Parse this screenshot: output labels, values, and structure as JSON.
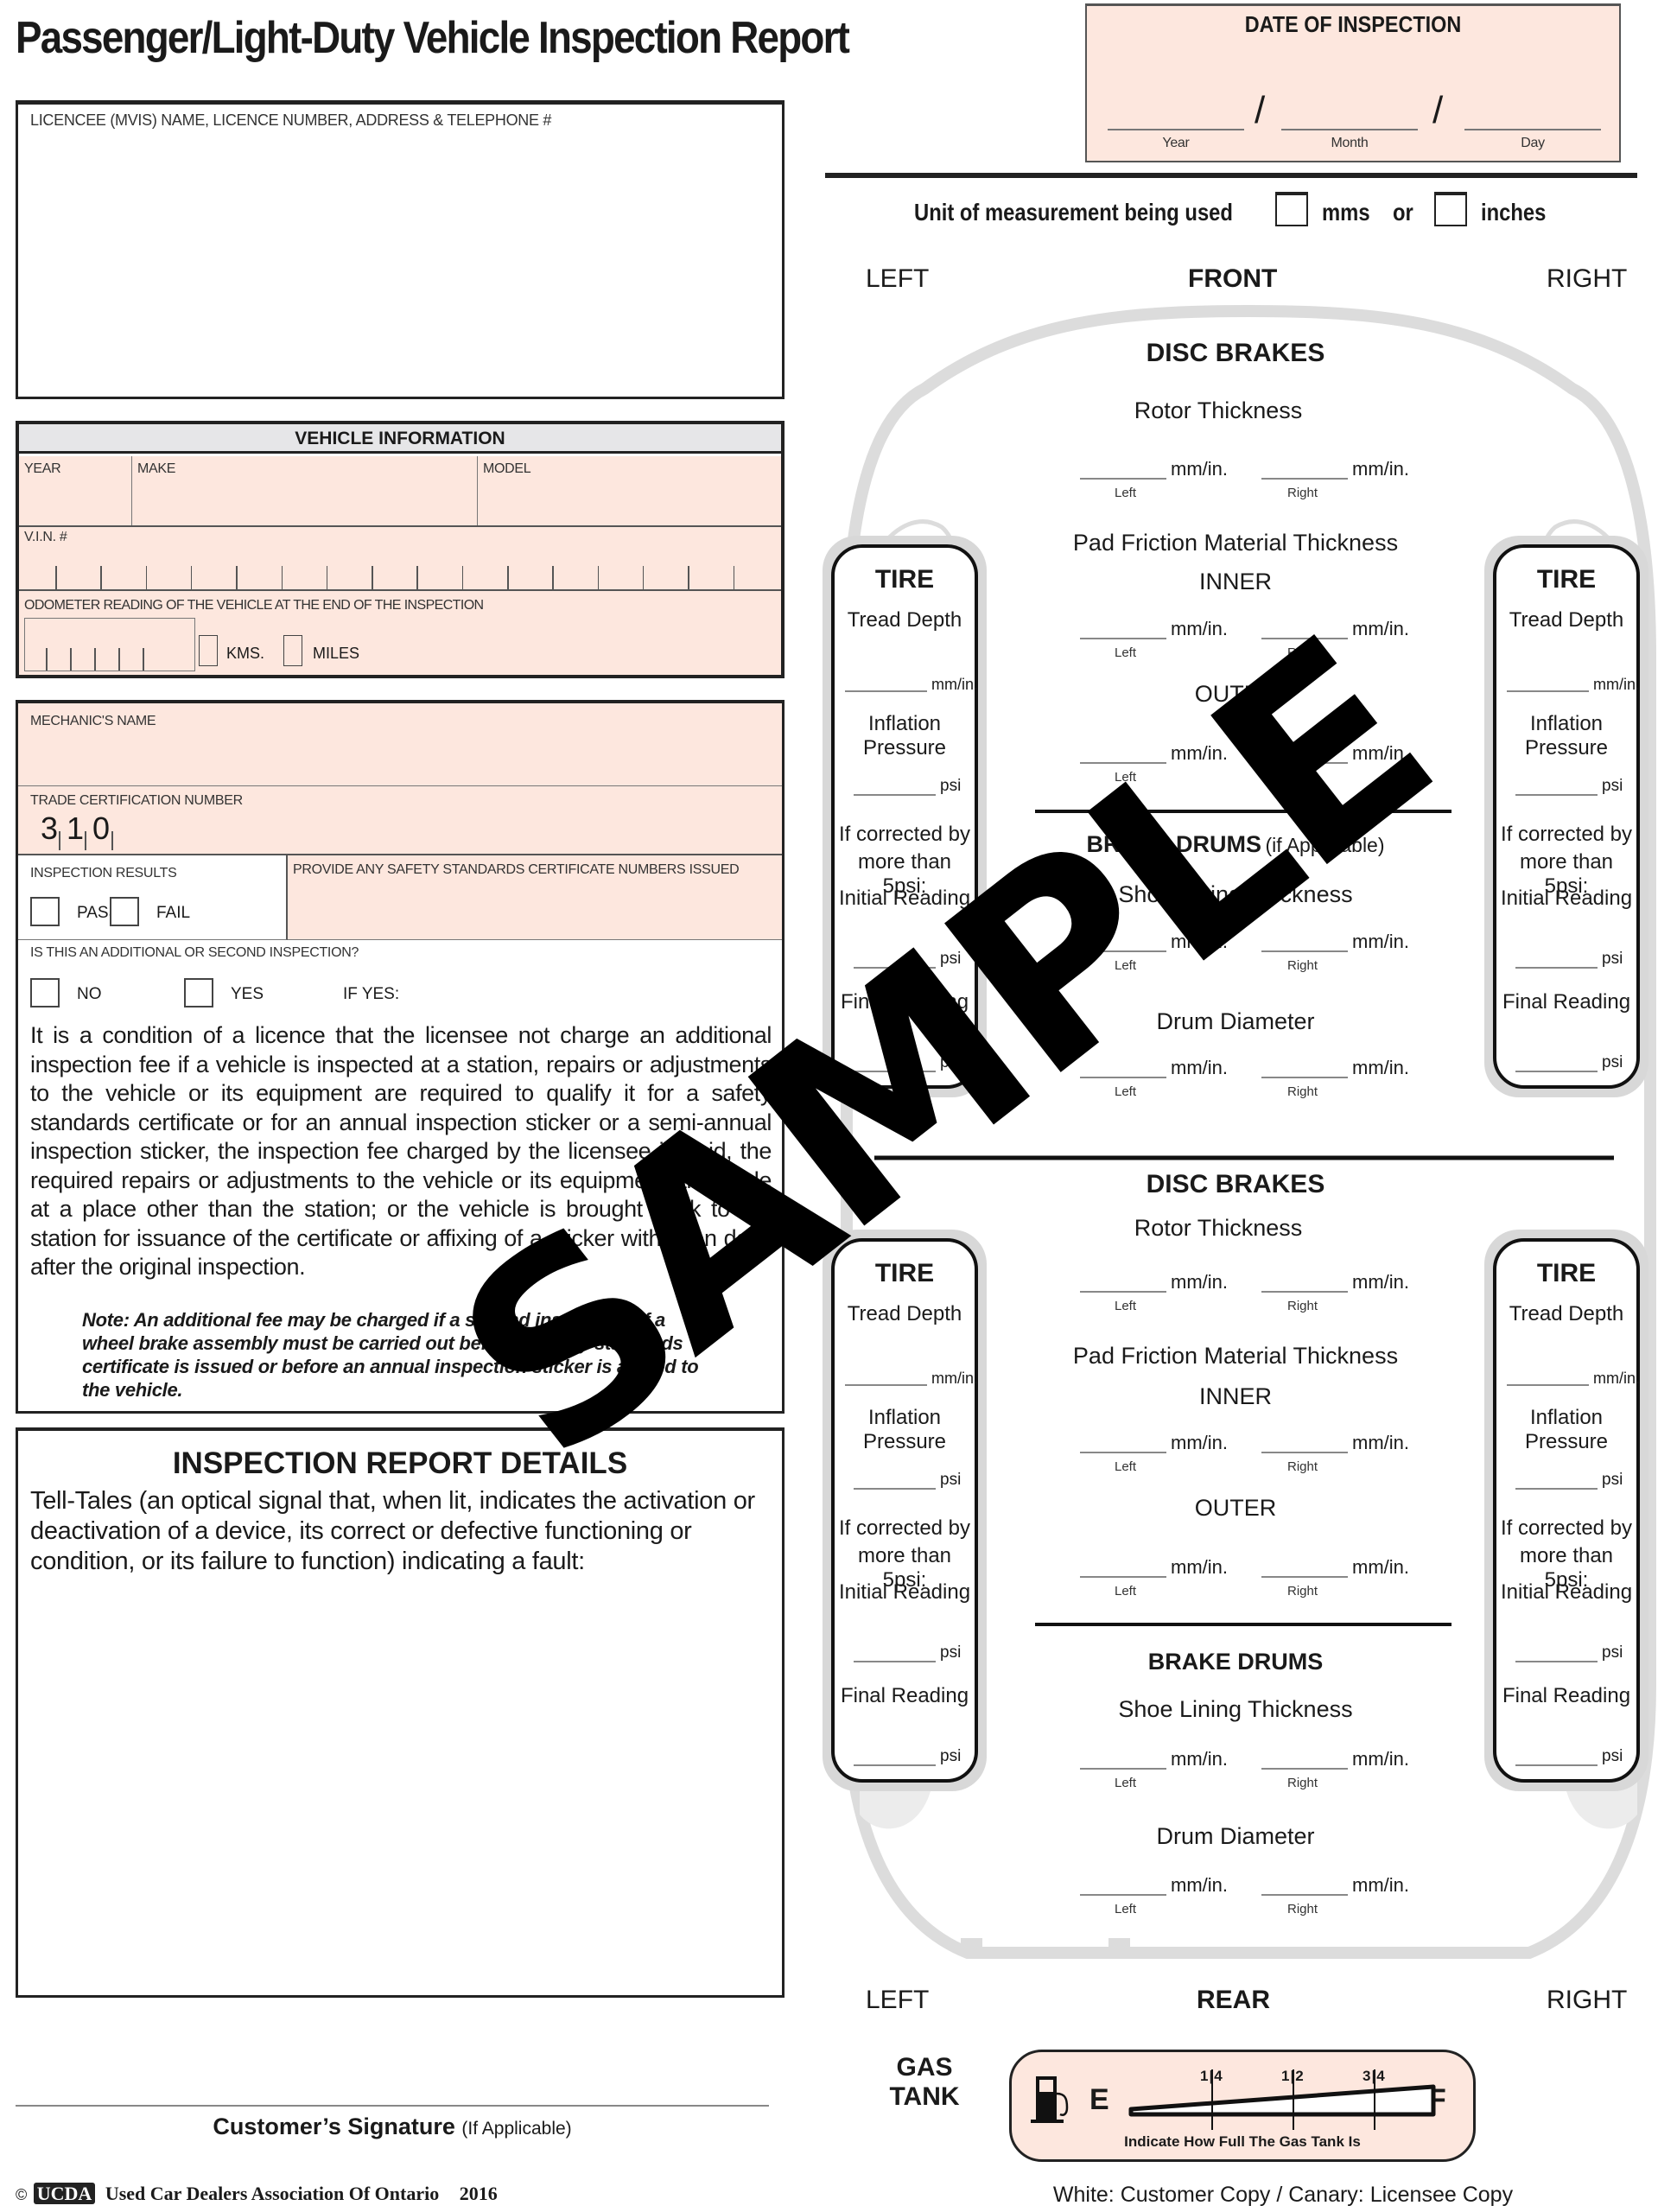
{
  "header": {
    "title": "Passenger/Light-Duty Vehicle Inspection Report"
  },
  "date_of_inspection": {
    "label": "DATE OF INSPECTION",
    "separator": "/",
    "fields": [
      {
        "label": "Year",
        "value": ""
      },
      {
        "label": "Month",
        "value": ""
      },
      {
        "label": "Day",
        "value": ""
      }
    ]
  },
  "licencee": {
    "label": "LICENCEE (MVIS) NAME, LICENCE NUMBER, ADDRESS & TELEPHONE #",
    "value": ""
  },
  "vehicle_info": {
    "heading": "VEHICLE INFORMATION",
    "year_label": "YEAR",
    "make_label": "MAKE",
    "model_label": "MODEL",
    "vin_label": "V.I.N. #",
    "vin_value": "",
    "odometer_label": "ODOMETER READING OF THE VEHICLE AT THE END OF THE INSPECTION",
    "odometer_value": "",
    "kms_label": "KMS.",
    "miles_label": "MILES",
    "kms_checked": false,
    "miles_checked": false
  },
  "mechanic": {
    "name_label": "MECHANIC'S NAME",
    "name_value": "",
    "trade_cert_label": "TRADE CERTIFICATION NUMBER",
    "trade_cert_digits": [
      "3",
      "1",
      "0"
    ]
  },
  "inspection_results": {
    "label": "INSPECTION RESULTS",
    "pass_label": "PASS",
    "fail_label": "FAIL",
    "pass_checked": false,
    "fail_checked": false,
    "certificates_label": "PROVIDE ANY SAFETY STANDARDS CERTIFICATE NUMBERS ISSUED"
  },
  "additional_inspection": {
    "question": "IS THIS AN ADDITIONAL OR SECOND INSPECTION?",
    "no_label": "NO",
    "yes_label": "YES",
    "if_yes_label": "IF YES:",
    "paragraph": "It is a condition of a licence that the licensee not charge an additional inspection fee if a vehicle is inspected at a station, repairs or adjustments to the vehicle or its equipment are required to qualify it for a safety standards certificate or for an annual inspection sticker or a semi-annual inspection sticker, the inspection fee charged by the licensee is paid, the required repairs or adjustments to the vehicle or its equipment are made at a place other than the station; or the vehicle is brought back to the station for issuance of the certificate or affixing of a sticker within ten days after the original inspection.",
    "note": "Note:  An additional fee may be charged if a second inspection of a wheel brake assembly must be carried out before a safety standards certificate is issued or before an annual inspection sticker is affixed to the vehicle."
  },
  "report_details": {
    "heading": "INSPECTION REPORT DETAILS",
    "text": "Tell-Tales (an optical signal that, when lit, indicates the activation or deactivation of a device, its correct or defective functioning or condition, or its failure to function) indicating a fault:"
  },
  "signature": {
    "label": "Customer’s Signature",
    "qualifier": "(If Applicable)"
  },
  "footer": {
    "copyright": "©",
    "logo": "UCDA",
    "org": "Used Car Dealers Association Of Ontario",
    "year": "2016",
    "copies": "White: Customer Copy / Canary: Licensee Copy"
  },
  "units": {
    "label": "Unit of measurement being used",
    "mms_label": "mms",
    "or_label": "or",
    "inches_label": "inches",
    "mms_checked": false,
    "inches_checked": false
  },
  "diagram": {
    "left": "LEFT",
    "right": "RIGHT",
    "front": "FRONT",
    "rear": "REAR",
    "unit_mm": "mm/in.",
    "unit_psi": "psi",
    "left_sub": "Left",
    "right_sub": "Right",
    "tire": {
      "title": "TIRE",
      "tread": "Tread Depth",
      "inflation": "Inflation Pressure",
      "corrected_1": "If corrected by",
      "corrected_2": "more than 5psi:",
      "initial": "Initial Reading",
      "final": "Final Reading"
    },
    "front_brakes": {
      "disc_heading": "DISC BRAKES",
      "rotor": "Rotor Thickness",
      "pad": "Pad Friction Material Thickness",
      "inner": "INNER",
      "outer": "OUTER",
      "drums_heading": "BRAKE DRUMS",
      "drums_qualifier": "(if Applicable)",
      "shoe": "Shoe Lining Thickness",
      "drum_diameter": "Drum Diameter"
    },
    "rear_brakes": {
      "disc_heading": "DISC BRAKES",
      "rotor": "Rotor Thickness",
      "pad": "Pad Friction Material Thickness",
      "inner": "INNER",
      "outer": "OUTER",
      "drums_heading": "BRAKE DRUMS",
      "shoe": "Shoe Lining Thickness",
      "drum_diameter": "Drum Diameter"
    }
  },
  "gas_tank": {
    "label_1": "GAS",
    "label_2": "TANK",
    "empty": "E",
    "full": "F",
    "ticks": [
      "1|4",
      "1|2",
      "3|4"
    ],
    "caption": "Indicate How Full The Gas Tank Is",
    "level": null
  },
  "watermark": "SAMPLE",
  "colors": {
    "form_pink": "#fde7de",
    "header_gray": "#e6e6e8",
    "diagram_gray": "#d8d8d8"
  }
}
